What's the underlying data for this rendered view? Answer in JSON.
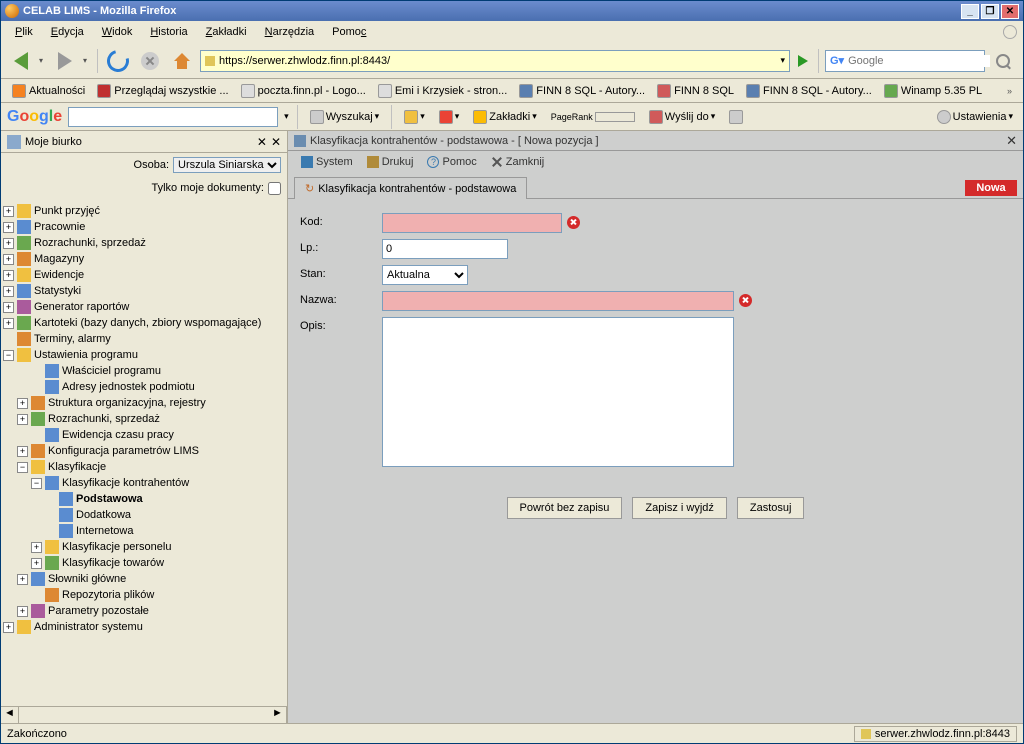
{
  "window": {
    "title": "CELAB LIMS - Mozilla Firefox"
  },
  "menu": {
    "file": "Plik",
    "edit": "Edycja",
    "view": "Widok",
    "history": "Historia",
    "bookmarks": "Zakładki",
    "tools": "Narzędzia",
    "help": "Pomoc"
  },
  "nav": {
    "url": "https://serwer.zhwlodz.finn.pl:8443/",
    "search_placeholder": "Google"
  },
  "bookmarks": [
    {
      "label": "Aktualności"
    },
    {
      "label": "Przeglądaj wszystkie ..."
    },
    {
      "label": "poczta.finn.pl - Logo..."
    },
    {
      "label": "Emi i Krzysiek - stron..."
    },
    {
      "label": "FINN 8 SQL - Autory..."
    },
    {
      "label": "FINN 8 SQL"
    },
    {
      "label": "FINN 8 SQL - Autory..."
    },
    {
      "label": "Winamp 5.35 PL"
    }
  ],
  "gbar": {
    "search": "Wyszukaj",
    "bookmarks": "Zakładki",
    "pagerank": "PageRank",
    "send": "Wyślij do",
    "settings": "Ustawienia"
  },
  "leftpane": {
    "title": "Moje biurko",
    "person": "Osoba:",
    "person_val": "Urszula Siniarska",
    "onlymine": "Tylko moje dokumenty:",
    "tree": [
      "Punkt przyjęć",
      "Pracownie",
      "Rozrachunki, sprzedaż",
      "Magazyny",
      "Ewidencje",
      "Statystyki",
      "Generator raportów",
      "Kartoteki (bazy danych, zbiory wspomagające)",
      "Terminy, alarmy",
      "Ustawienia programu",
      "Właściciel programu",
      "Adresy jednostek podmiotu",
      "Struktura organizacyjna, rejestry",
      "Rozrachunki, sprzedaż",
      "Ewidencja czasu pracy",
      "Konfiguracja parametrów LIMS",
      "Klasyfikacje",
      "Klasyfikacje kontrahentów",
      "Podstawowa",
      "Dodatkowa",
      "Internetowa",
      "Klasyfikacje personelu",
      "Klasyfikacje towarów",
      "Słowniki główne",
      "Repozytoria plików",
      "Parametry pozostałe",
      "Administrator systemu"
    ]
  },
  "rightpane": {
    "title": "Klasyfikacja kontrahentów - podstawowa - [ Nowa pozycja ]",
    "toolbar": {
      "system": "System",
      "print": "Drukuj",
      "help": "Pomoc",
      "close": "Zamknij"
    },
    "tab": "Klasyfikacja kontrahentów - podstawowa",
    "badge": "Nowa",
    "form": {
      "kod": "Kod:",
      "lp": "Lp.:",
      "lp_val": "0",
      "stan": "Stan:",
      "stan_val": "Aktualna",
      "nazwa": "Nazwa:",
      "opis": "Opis:",
      "btn_back": "Powrót bez zapisu",
      "btn_save": "Zapisz i wyjdź",
      "btn_apply": "Zastosuj"
    }
  },
  "status": {
    "done": "Zakończono",
    "server": "serwer.zhwlodz.finn.pl:8443"
  }
}
